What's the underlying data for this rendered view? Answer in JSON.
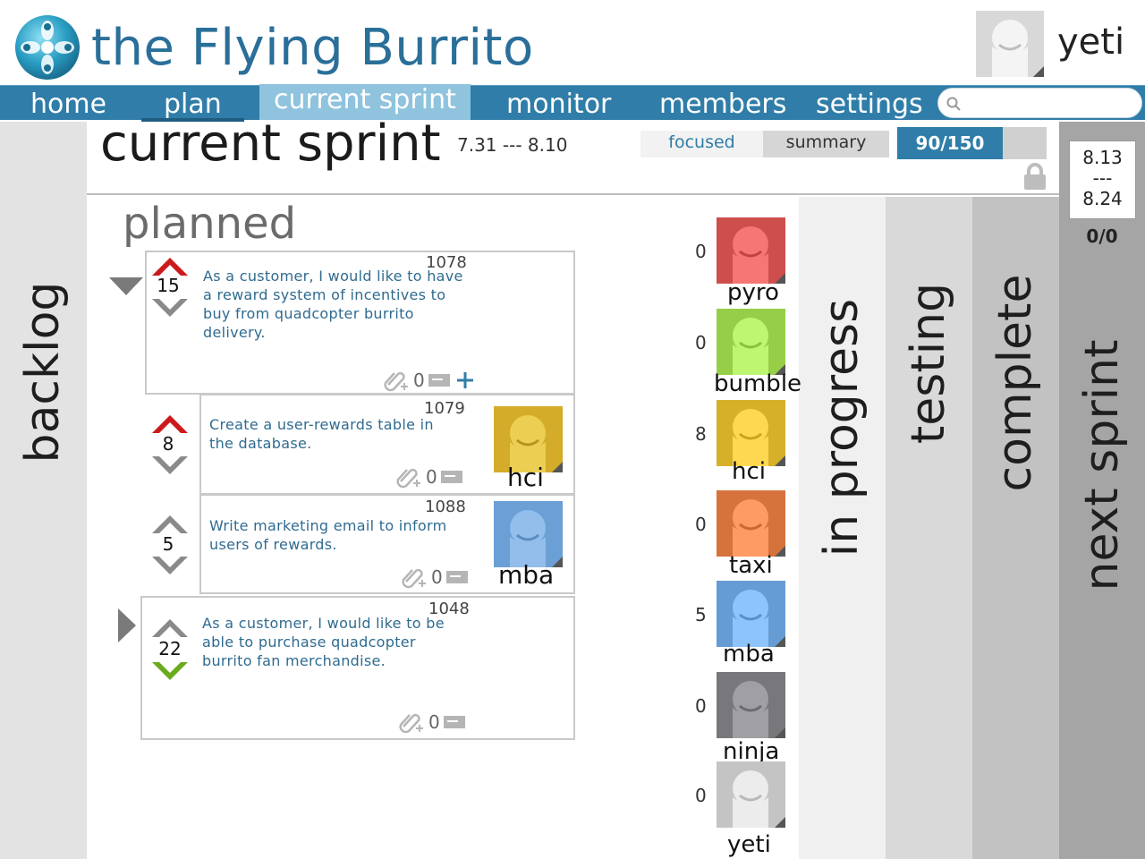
{
  "app": {
    "title": "the Flying Burrito",
    "username": "yeti"
  },
  "nav": {
    "items": [
      {
        "label": "home"
      },
      {
        "label": "plan"
      },
      {
        "label": "current sprint"
      },
      {
        "label": "monitor"
      },
      {
        "label": "members"
      },
      {
        "label": "settings"
      }
    ],
    "active_index": 2,
    "search_placeholder": ""
  },
  "columns": {
    "backlog": "backlog",
    "in_progress": "in progress",
    "testing": "testing",
    "complete": "complete",
    "next_sprint": "next sprint"
  },
  "sprint": {
    "title": "current sprint",
    "dates": "7.31 --- 8.10",
    "view_focused": "focused",
    "view_summary": "summary",
    "capacity_text": "90/150",
    "capacity_fraction": 0.6,
    "section": "planned"
  },
  "next_sprint": {
    "start": "8.13",
    "separator": "---",
    "end": "8.24",
    "count": "0/0"
  },
  "stories": [
    {
      "id": "1078",
      "points": "15",
      "text": [
        "As a customer, I would like to have",
        "a reward system of  incentives to",
        "buy from quadcopter burrito",
        "delivery."
      ],
      "attachments": "0",
      "up_color": "#cc1a1a",
      "down_color": "#8a8a8a",
      "assignee": ""
    },
    {
      "id": "1079",
      "points": "8",
      "text": [
        "Create a user-rewards table in",
        "the database."
      ],
      "attachments": "0",
      "up_color": "#cc1a1a",
      "down_color": "#8a8a8a",
      "assignee": "hci"
    },
    {
      "id": "1088",
      "points": "5",
      "text": [
        "Write marketing email to inform",
        "users of  rewards."
      ],
      "attachments": "0",
      "up_color": "#8a8a8a",
      "down_color": "#8a8a8a",
      "assignee": "mba"
    },
    {
      "id": "1048",
      "points": "22",
      "text": [
        "As a customer, I would like to be",
        "able to purchase quadcopter",
        "burrito fan merchandise."
      ],
      "attachments": "0",
      "up_color": "#8a8a8a",
      "down_color": "#6aab1e",
      "assignee": ""
    }
  ],
  "team": [
    {
      "name": "pyro",
      "points": "0",
      "color": "#e0605e"
    },
    {
      "name": "bumble",
      "points": "0",
      "color": "#a8e05a"
    },
    {
      "name": "hci",
      "points": "8",
      "color": "#e8c23a"
    },
    {
      "name": "taxi",
      "points": "0",
      "color": "#e8854e"
    },
    {
      "name": "mba",
      "points": "5",
      "color": "#78aee6"
    },
    {
      "name": "ninja",
      "points": "0",
      "color": "#8a8a8e"
    },
    {
      "name": "yeti",
      "points": "0",
      "color": "#d6d6d6"
    }
  ]
}
